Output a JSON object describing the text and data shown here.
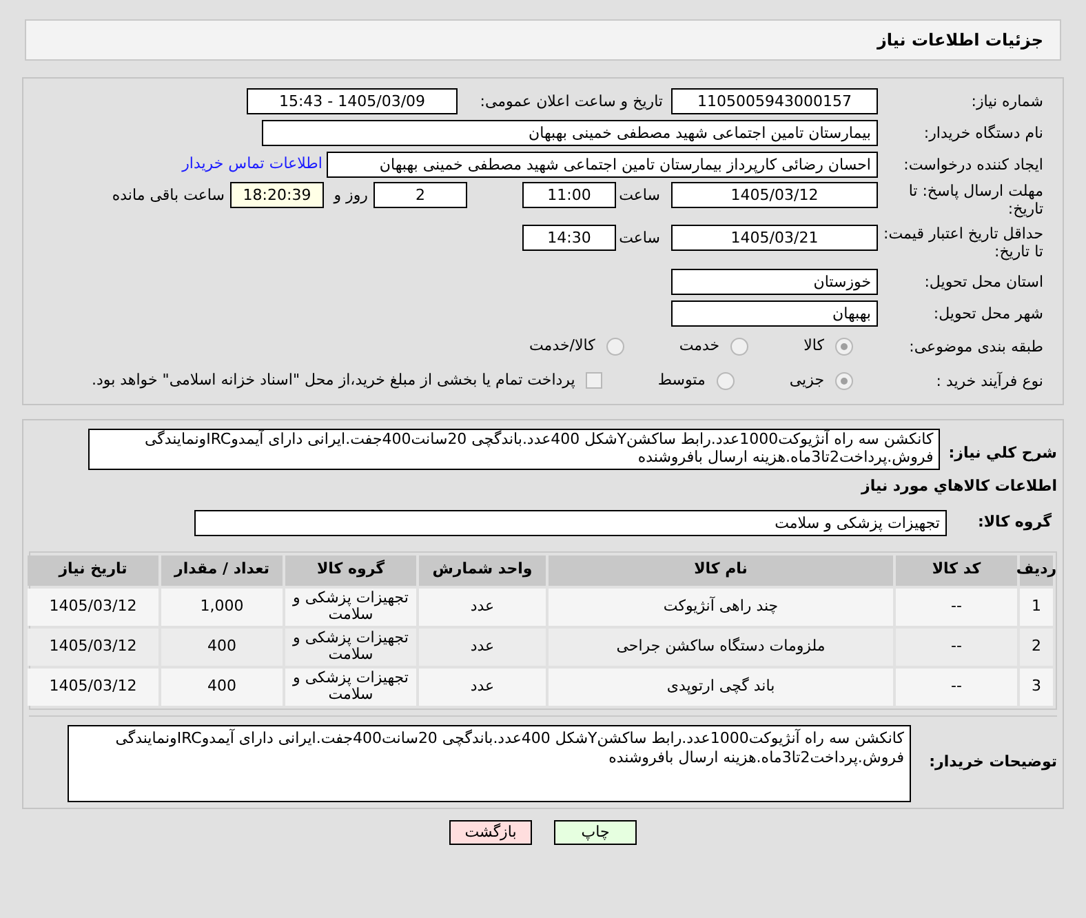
{
  "header": {
    "title": "جزئیات اطلاعات نیاز"
  },
  "details": {
    "need_number": {
      "label": "شماره نیاز:",
      "value": "1105005943000157"
    },
    "announce": {
      "label": "تاریخ و ساعت اعلان عمومی:",
      "value": "1405/03/09 - 15:43"
    },
    "buyer_org": {
      "label": "نام دستگاه خریدار:",
      "value": "بیمارستان تامین اجتماعی شهید مصطفی خمینی بهبهان"
    },
    "requester": {
      "label": "ایجاد کننده درخواست:",
      "value": "احسان رضائی کارپرداز بیمارستان تامین اجتماعی شهید مصطفی خمینی بهبهان",
      "link": "اطلاعات تماس خریدار"
    },
    "reply_deadline": {
      "label": "مهلت ارسال پاسخ: تا تاریخ:",
      "date": "1405/03/12",
      "time_label": "ساعت",
      "time": "11:00",
      "days": "2",
      "days_label": "روز و",
      "remaining": "18:20:39",
      "remaining_label": "ساعت باقی مانده"
    },
    "price_validity": {
      "label": "حداقل تاریخ اعتبار قیمت: تا تاریخ:",
      "date": "1405/03/21",
      "time_label": "ساعت",
      "time": "14:30"
    },
    "province": {
      "label": "استان محل تحویل:",
      "value": "خوزستان"
    },
    "city": {
      "label": "شهر محل تحویل:",
      "value": "بهبهان"
    },
    "category": {
      "label": "طبقه بندی موضوعی:",
      "options": [
        {
          "label": "کالا",
          "selected": true
        },
        {
          "label": "خدمت",
          "selected": false
        },
        {
          "label": "کالا/خدمت",
          "selected": false
        }
      ]
    },
    "process": {
      "label": "نوع فرآیند خرید :",
      "options": [
        {
          "label": "جزیی",
          "selected": true
        },
        {
          "label": "متوسط",
          "selected": false
        }
      ],
      "payment": {
        "label": "پرداخت تمام یا بخشی از مبلغ خرید،از محل \"اسناد خزانه اسلامی\" خواهد بود.",
        "checked": false
      }
    }
  },
  "description": {
    "label": "شرح کلي نیاز:",
    "value": "کانکشن سه راه آنژیوکت1000عدد.رابط ساکشنYشکل 400عدد.باندگچی 20سانت400جفت.ایرانی دارای آیمدوIRCونمایندگی فروش.پرداخت2تا3ماه.هزینه ارسال بافروشنده"
  },
  "items_heading": "اطلاعات کالاهاي مورد نیاز",
  "goods_group": {
    "label": "گروه کالا:",
    "value": "تجهیزات پزشکی و سلامت"
  },
  "table": {
    "columns": [
      "ردیف",
      "کد کالا",
      "نام کالا",
      "واحد شمارش",
      "گروه کالا",
      "تعداد / مقدار",
      "تاریخ نیاز"
    ],
    "rows": [
      [
        "1",
        "--",
        "چند راهی آنژیوکت",
        "عدد",
        "تجهیزات پزشکی و سلامت",
        "1,000",
        "1405/03/12"
      ],
      [
        "2",
        "--",
        "ملزومات دستگاه ساکشن جراحی",
        "عدد",
        "تجهیزات پزشکی و سلامت",
        "400",
        "1405/03/12"
      ],
      [
        "3",
        "--",
        "باند گچی ارتوپدی",
        "عدد",
        "تجهیزات پزشکی و سلامت",
        "400",
        "1405/03/12"
      ]
    ]
  },
  "buyer_notes": {
    "label": "توضیحات خریدار:",
    "value": "کانکشن سه راه آنژیوکت1000عدد.رابط ساکشنYشکل 400عدد.باندگچی 20سانت400جفت.ایرانی دارای آیمدوIRCونمایندگی فروش.پرداخت2تا3ماه.هزینه ارسال بافروشنده"
  },
  "buttons": [
    {
      "kind": "print",
      "label": "چاپ"
    },
    {
      "kind": "back",
      "label": "بازگشت"
    }
  ]
}
